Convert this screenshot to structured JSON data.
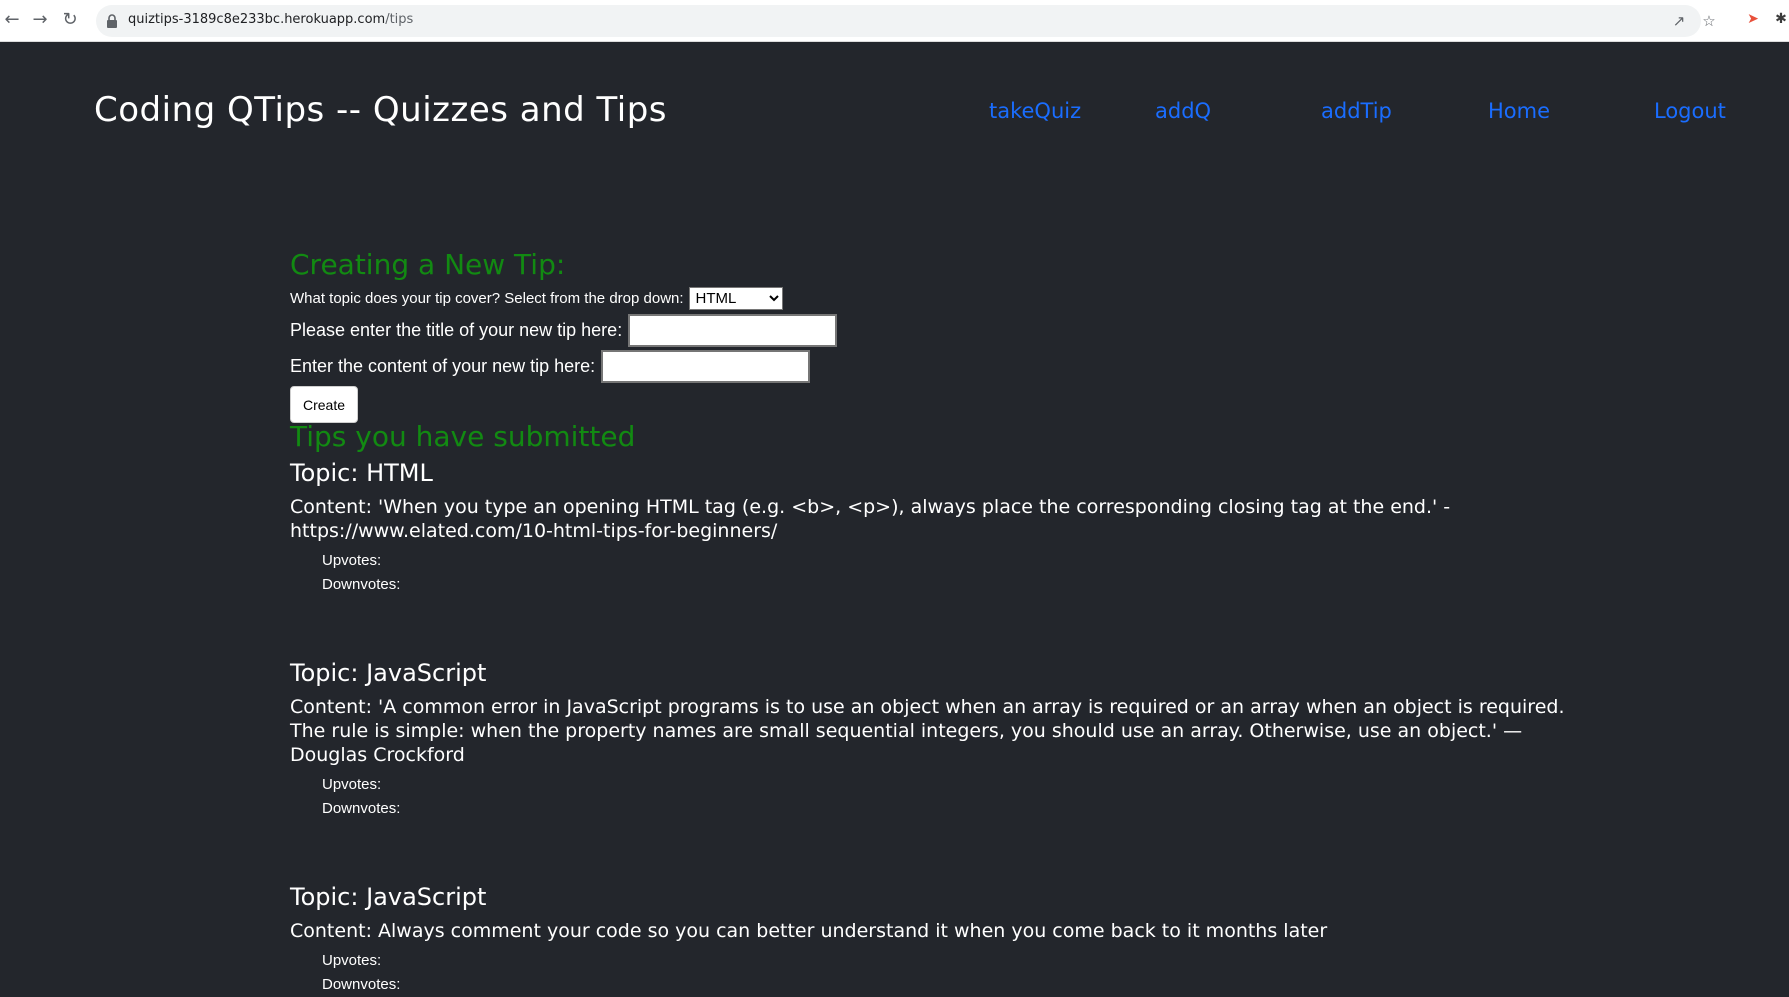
{
  "browser": {
    "url_host": "quiztips-3189c8e233bc.herokuapp.com",
    "url_path": "/tips"
  },
  "header": {
    "title": "Coding QTips -- Quizzes and Tips",
    "nav": [
      "takeQuiz",
      "addQ",
      "addTip",
      "Home",
      "Logout"
    ]
  },
  "form": {
    "heading": "Creating a New Tip:",
    "topic_label": "What topic does your tip cover? Select from the drop down:",
    "topic_selected": "HTML",
    "title_label": "Please enter the title of your new tip here:",
    "content_label": "Enter the content of your new tip here:",
    "create_label": "Create"
  },
  "submitted": {
    "heading": "Tips you have submitted",
    "tips": [
      {
        "topic": "Topic: HTML",
        "content": "Content: 'When you type an opening HTML tag (e.g. <b>, <p>), always place the corresponding closing tag at the end.' - https://www.elated.com/10-html-tips-for-beginners/",
        "upvotes": "Upvotes:",
        "downvotes": "Downvotes:"
      },
      {
        "topic": "Topic: JavaScript",
        "content": "Content: 'A common error in JavaScript programs is to use an object when an array is required or an array when an object is required. The rule is simple: when the property names are small sequential integers, you should use an array. Otherwise, use an object.' — Douglas Crockford",
        "upvotes": "Upvotes:",
        "downvotes": "Downvotes:"
      },
      {
        "topic": "Topic: JavaScript",
        "content": "Content: Always comment your code so you can better understand it when you come back to it months later",
        "upvotes": "Upvotes:",
        "downvotes": "Downvotes:"
      }
    ]
  },
  "colors": {
    "background": "#23262c",
    "heading_green": "#128a12",
    "link_blue": "#1a6dff"
  }
}
